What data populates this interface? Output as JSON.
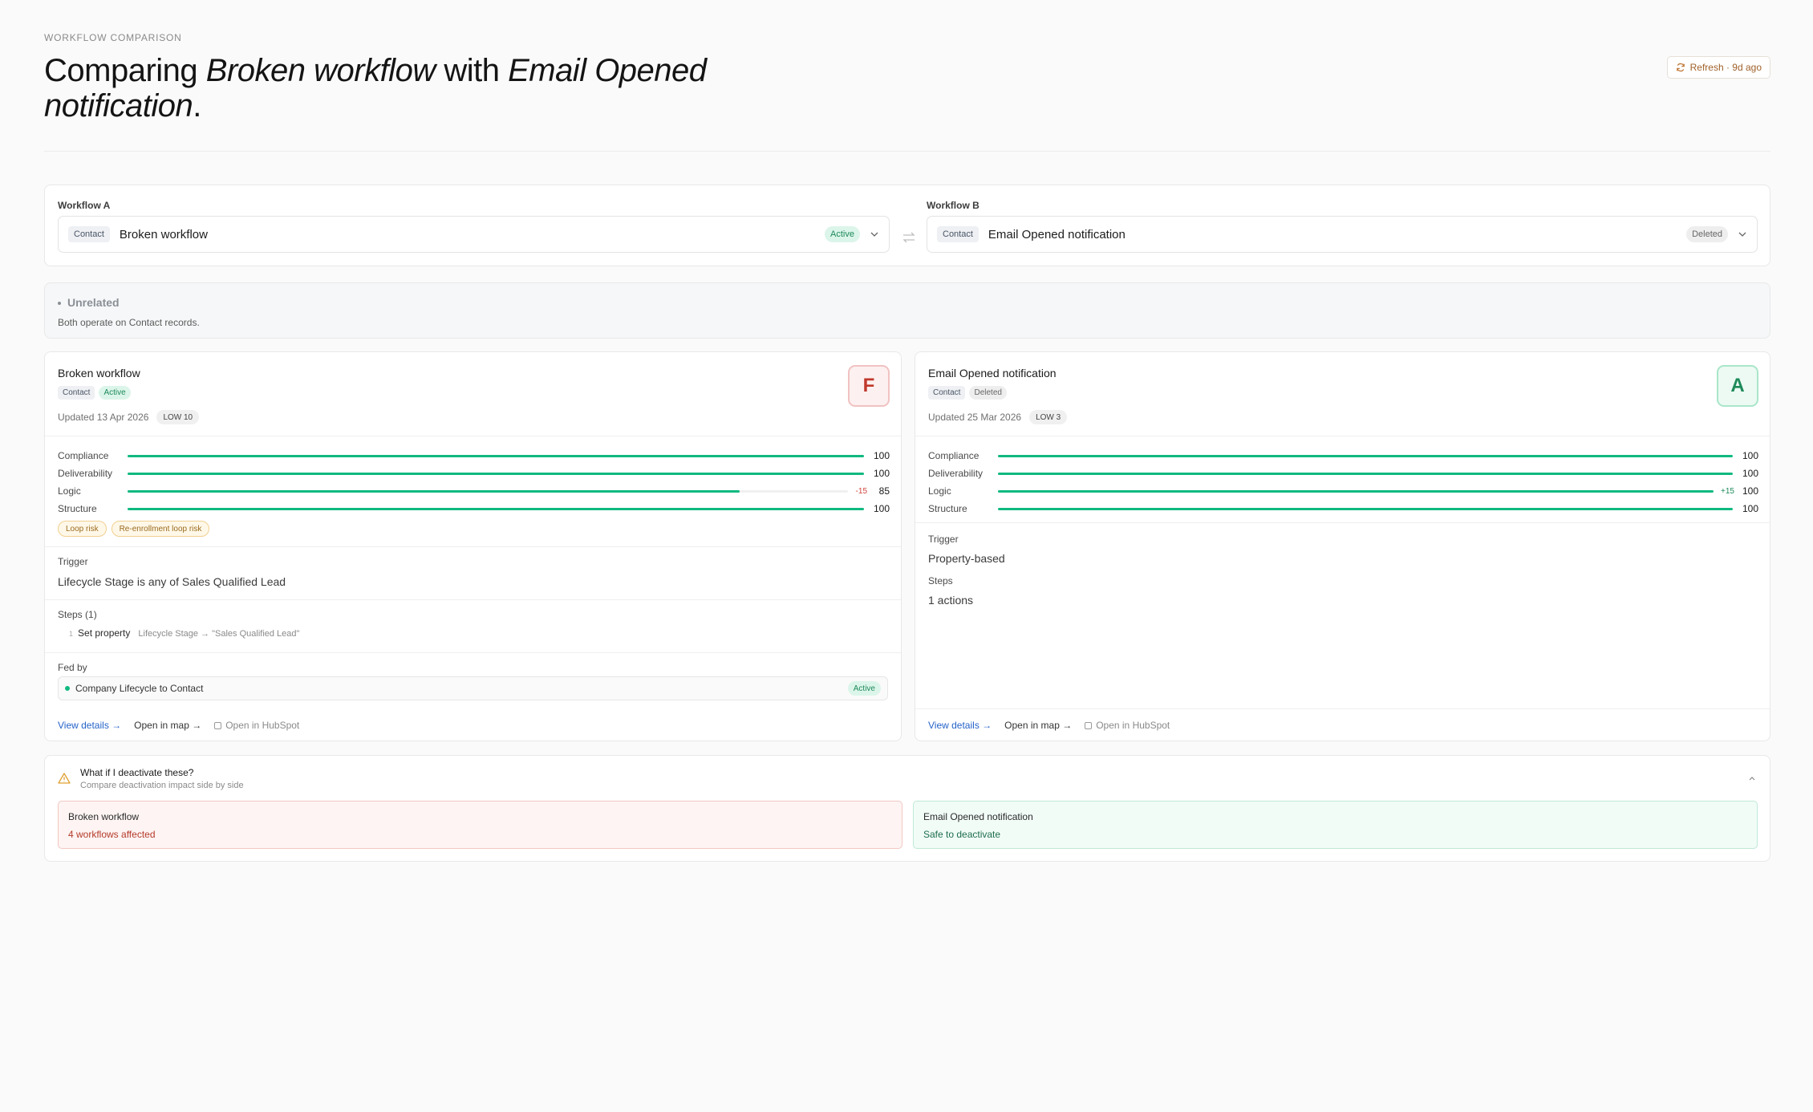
{
  "header": {
    "eyebrow": "WORKFLOW COMPARISON",
    "title_prefix": "Comparing ",
    "title_a": "Broken workflow",
    "title_mid": " with ",
    "title_b": "Email Opened notification",
    "title_suffix": ".",
    "refresh_label": "Refresh · 9d ago"
  },
  "selector": {
    "a": {
      "label": "Workflow A",
      "object": "Contact",
      "name": "Broken workflow",
      "status": "Active"
    },
    "b": {
      "label": "Workflow B",
      "object": "Contact",
      "name": "Email Opened notification",
      "status": "Deleted"
    }
  },
  "relation": {
    "title": "Unrelated",
    "description": "Both operate on Contact records."
  },
  "panels": {
    "a": {
      "name": "Broken workflow",
      "object": "Contact",
      "status": "Active",
      "updated": "Updated 13 Apr 2026",
      "risk_level": "LOW 10",
      "grade": "F",
      "metrics": [
        {
          "label": "Compliance",
          "value": "100",
          "fraction": 1.0,
          "delta": ""
        },
        {
          "label": "Deliverability",
          "value": "100",
          "fraction": 1.0,
          "delta": ""
        },
        {
          "label": "Logic",
          "value": "85",
          "fraction": 0.85,
          "delta": "-15"
        },
        {
          "label": "Structure",
          "value": "100",
          "fraction": 1.0,
          "delta": ""
        }
      ],
      "risks": [
        "Loop risk",
        "Re-enrollment loop risk"
      ],
      "trigger_label": "Trigger",
      "trigger_value": "Lifecycle Stage is any of Sales Qualified Lead",
      "steps_label": "Steps (1)",
      "steps": [
        {
          "num": "1",
          "action": "Set property",
          "detail": "Lifecycle Stage → \"Sales Qualified Lead\""
        }
      ],
      "fed_by_label": "Fed by",
      "fed_by": [
        {
          "name": "Company Lifecycle to Contact",
          "status": "Active"
        }
      ],
      "actions": {
        "details": "View details →",
        "map": "Open in map →",
        "hubspot": "Open in HubSpot"
      }
    },
    "b": {
      "name": "Email Opened notification",
      "object": "Contact",
      "status": "Deleted",
      "updated": "Updated 25 Mar 2026",
      "risk_level": "LOW 3",
      "grade": "A",
      "metrics": [
        {
          "label": "Compliance",
          "value": "100",
          "fraction": 1.0,
          "delta": ""
        },
        {
          "label": "Deliverability",
          "value": "100",
          "fraction": 1.0,
          "delta": ""
        },
        {
          "label": "Logic",
          "value": "100",
          "fraction": 1.0,
          "delta": "+15"
        },
        {
          "label": "Structure",
          "value": "100",
          "fraction": 1.0,
          "delta": ""
        }
      ],
      "trigger_label": "Trigger",
      "trigger_value": "Property-based",
      "steps_label": "Steps",
      "steps_value": "1 actions",
      "actions": {
        "details": "View details →",
        "map": "Open in map →",
        "hubspot": "Open in HubSpot"
      }
    }
  },
  "deactivate": {
    "title": "What if I deactivate these?",
    "subtitle": "Compare deactivation impact side by side",
    "a": {
      "name": "Broken workflow",
      "impact": "4 workflows affected"
    },
    "b": {
      "name": "Email Opened notification",
      "impact": "Safe to deactivate"
    }
  },
  "colors": {
    "accent_green": "#10b981",
    "danger_red": "#c0392b",
    "link_blue": "#2563c9",
    "warning_amber": "#e0a030"
  },
  "icons": {
    "refresh": "refresh-icon",
    "chevron": "chevron-down-icon",
    "swap": "swap-icon",
    "warning": "warning-triangle-icon",
    "collapse": "chevron-up-icon",
    "external": "external-square-icon"
  }
}
